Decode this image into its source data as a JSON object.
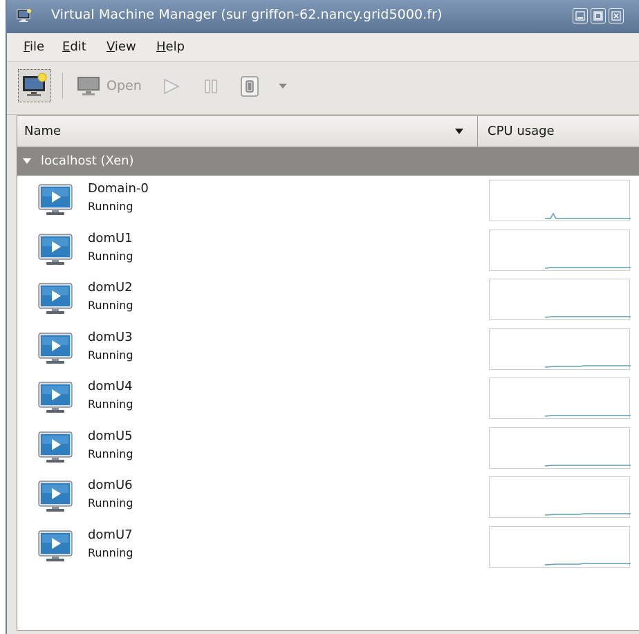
{
  "window": {
    "title": "Virtual Machine Manager (sur griffon-62.nancy.grid5000.fr)",
    "icon": "vm-manager-app-icon",
    "controls": [
      "minimize-icon",
      "maximize-icon",
      "close-icon"
    ]
  },
  "menubar": {
    "items": [
      {
        "label": "File",
        "mnemonic": "F",
        "rest": "ile"
      },
      {
        "label": "Edit",
        "mnemonic": "E",
        "rest": "dit"
      },
      {
        "label": "View",
        "mnemonic": "V",
        "rest": "iew"
      },
      {
        "label": "Help",
        "mnemonic": "H",
        "rest": "elp"
      }
    ]
  },
  "toolbar": {
    "new_vm_icon": "new-vm-icon",
    "open_label": "Open",
    "run_icon": "run-icon",
    "pause_icon": "pause-icon",
    "shutdown_icon": "shutdown-icon",
    "dropdown_icon": "chevron-down-icon"
  },
  "list": {
    "columns": {
      "name": "Name",
      "cpu": "CPU usage"
    },
    "group": {
      "label": "localhost (Xen)",
      "expanded": true
    },
    "vms": [
      {
        "name": "Domain-0",
        "status": "Running"
      },
      {
        "name": "domU1",
        "status": "Running"
      },
      {
        "name": "domU2",
        "status": "Running"
      },
      {
        "name": "domU3",
        "status": "Running"
      },
      {
        "name": "domU4",
        "status": "Running"
      },
      {
        "name": "domU5",
        "status": "Running"
      },
      {
        "name": "domU6",
        "status": "Running"
      },
      {
        "name": "domU7",
        "status": "Running"
      }
    ]
  },
  "colors": {
    "titlebar": "#6a84a6",
    "group_row": "#8b8985",
    "graph_line": "#5f9fb3",
    "vm_icon_blue": "#2f7fc0"
  }
}
